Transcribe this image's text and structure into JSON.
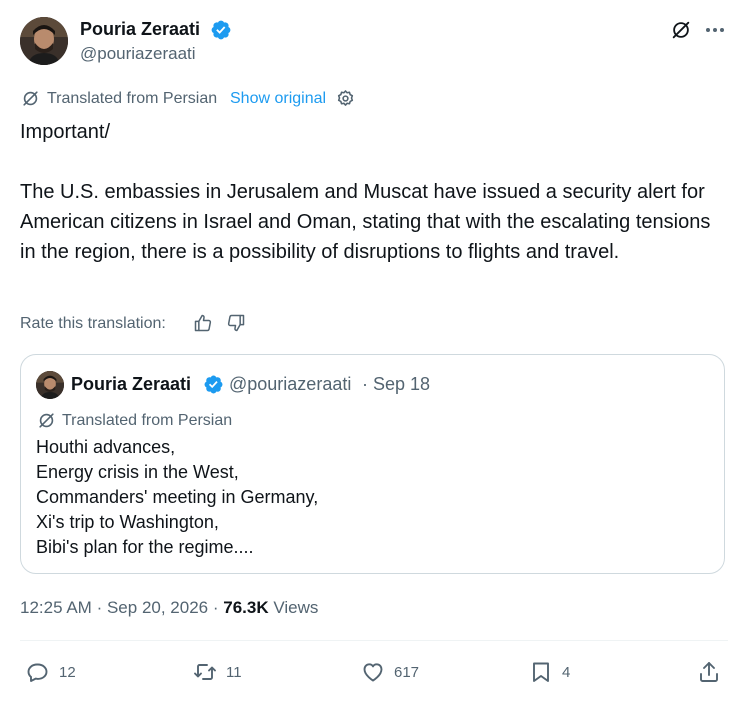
{
  "author": {
    "name": "Pouria Zeraati",
    "handle": "@pouriazeraati"
  },
  "translation": {
    "label": "Translated from Persian",
    "show_original": "Show original"
  },
  "tweet": {
    "paragraphs": [
      "Important/",
      "The U.S. embassies in Jerusalem and Muscat have issued a security alert for American citizens in Israel and Oman, stating that with the escalating tensions in the region, there is a possibility of disruptions to flights and travel."
    ]
  },
  "rate_translation": {
    "label": "Rate this translation:"
  },
  "quote_tweet": {
    "author_name": "Pouria Zeraati",
    "handle": "@pouriazeraati",
    "separator": "·",
    "date": "Sep 18",
    "translated_label": "Translated from Persian",
    "lines": [
      "Houthi advances,",
      "Energy crisis in the West,",
      "Commanders' meeting in Germany,",
      "Xi's trip to Washington,",
      "Bibi's plan for the regime...."
    ]
  },
  "meta": {
    "time": "12:25 AM",
    "separator": "·",
    "date": "Sep 20, 2026",
    "views_count": "76.3K",
    "views_label": "Views"
  },
  "actions": {
    "reply_count": "12",
    "repost_count": "11",
    "like_count": "617",
    "bookmark_count": "4"
  },
  "colors": {
    "text_primary": "#0f1419",
    "text_secondary": "#536471",
    "link": "#1d9bf0",
    "border": "#cfd9de"
  },
  "icons": {
    "verified": "verified-badge-icon",
    "grok": "grok-icon",
    "more": "more-options-icon",
    "translate": "translate-icon",
    "settings": "gear-icon",
    "thumbs_up": "thumbs-up-icon",
    "thumbs_down": "thumbs-down-icon",
    "reply": "reply-icon",
    "repost": "repost-icon",
    "like": "heart-icon",
    "bookmark": "bookmark-icon",
    "share": "share-icon"
  }
}
